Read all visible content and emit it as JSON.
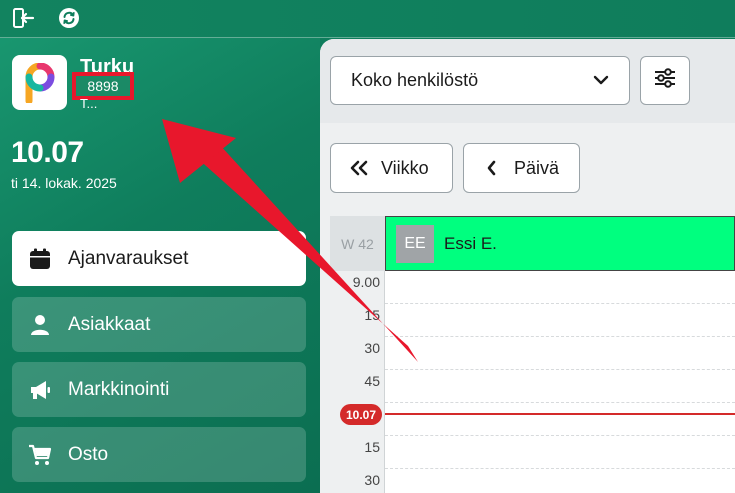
{
  "topbar": {
    "icons": [
      "logout-icon",
      "refresh-icon"
    ]
  },
  "org": {
    "name": "Turku",
    "code": "8898",
    "sub": "T..."
  },
  "clock": {
    "time": "10.07",
    "date": "ti 14. lokak. 2025"
  },
  "nav": {
    "items": [
      {
        "label": "Ajanvaraukset",
        "icon": "calendar-icon",
        "active": true
      },
      {
        "label": "Asiakkaat",
        "icon": "person-icon",
        "active": false
      },
      {
        "label": "Markkinointi",
        "icon": "megaphone-icon",
        "active": false
      },
      {
        "label": "Osto",
        "icon": "cart-icon",
        "active": false
      }
    ]
  },
  "main": {
    "staff_select": {
      "value": "Koko henkilöstö"
    },
    "week_button": "Viikko",
    "day_button": "Päivä",
    "week_label": "W 42",
    "staff": {
      "initials": "EE",
      "name": "Essi E.",
      "color": "#00ff7f"
    },
    "time_labels": [
      "9.00",
      "15",
      "30",
      "45",
      "",
      "15",
      "30"
    ],
    "now_badge": "10.07"
  },
  "colors": {
    "accent_green": "#0f7d5c",
    "highlight_red": "#e8172c",
    "now_red": "#d42a2a"
  }
}
